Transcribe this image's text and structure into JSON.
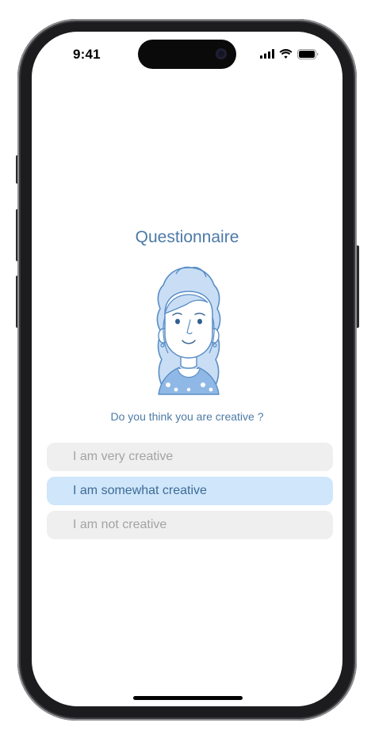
{
  "status_bar": {
    "time": "9:41",
    "icons": [
      "cellular-signal-icon",
      "wifi-icon",
      "battery-icon"
    ]
  },
  "screen": {
    "title": "Questionnaire",
    "illustration": "woman-avatar-illustration",
    "question": "Do you think you are creative ?",
    "options": [
      {
        "label": "I am very creative",
        "selected": false
      },
      {
        "label": "I am somewhat creative",
        "selected": true
      },
      {
        "label": "I am not creative",
        "selected": false
      }
    ]
  },
  "colors": {
    "accent": "#4d7aa6",
    "selected_bg": "#cfe6fb",
    "option_bg": "#efefef",
    "option_text": "#a3a3a3",
    "illustration_fill": "#c9def5"
  }
}
